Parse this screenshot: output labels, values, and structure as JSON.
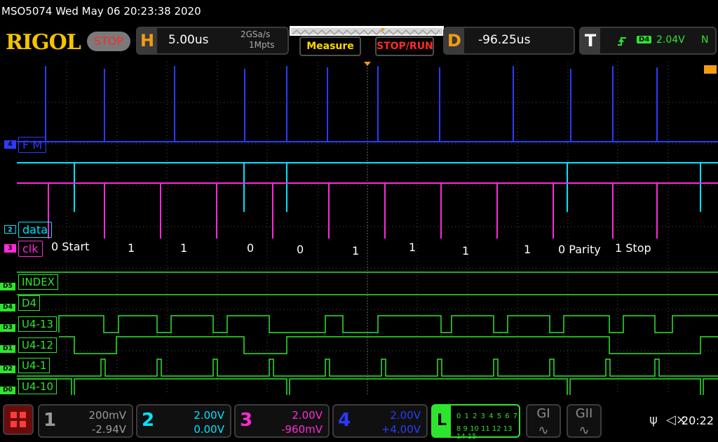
{
  "title_bar": {
    "info": "MSO5074  Wed May 06 20:23:38 2020"
  },
  "logo": "RIGOL",
  "status_button": "STOP",
  "horizontal": {
    "key": "H",
    "timebase": "5.00us",
    "sample_rate": "2GSa/s",
    "memory_depth": "1Mpts"
  },
  "buttons": {
    "measure": "Measure",
    "stop_run": "STOP/RUN"
  },
  "delay": {
    "key": "D",
    "value": "-96.25us"
  },
  "trigger": {
    "key": "T",
    "source": "D4",
    "level": "2.04V",
    "mode": "N"
  },
  "channels": [
    {
      "number": "1",
      "scale": "200mV",
      "offset": "-2.94V",
      "color": "#9a9a9a"
    },
    {
      "number": "2",
      "scale": "2.00V",
      "offset": "0.00V",
      "color": "#00e5ff"
    },
    {
      "number": "3",
      "scale": "2.00V",
      "offset": "-960mV",
      "color": "#ff2bd6"
    },
    {
      "number": "4",
      "scale": "2.00V",
      "offset": "+4.00V",
      "color": "#2a3bff"
    }
  ],
  "waveform_labels": {
    "ch4": "F M",
    "ch2": "data",
    "ch3": "clk",
    "ch4_marker": "4",
    "ch2_marker": "2",
    "ch3_marker": "3"
  },
  "annotations": [
    "0 Start",
    "1",
    "1",
    "0",
    "0",
    "1",
    "1",
    "1",
    "1",
    "0 Parity",
    "1 Stop"
  ],
  "digital_channels": [
    {
      "marker": "D5",
      "label": "INDEX"
    },
    {
      "marker": "D4",
      "label": "D4"
    },
    {
      "marker": "D3",
      "label": "U4-13"
    },
    {
      "marker": "D1",
      "label": "U4-12"
    },
    {
      "marker": "D2",
      "label": "U4-1"
    },
    {
      "marker": "D0",
      "label": "U4-10"
    }
  ],
  "la_panel": {
    "key": "L",
    "row1": "0 1 2 3  4 5 6 7",
    "row2": "8 9 10 11  12 13 14 15"
  },
  "generators": [
    {
      "label": "GI"
    },
    {
      "label": "GII"
    }
  ],
  "clock": "20:22",
  "icons": {
    "usb": "usb-icon",
    "sound": "mute-icon",
    "menu": "menu-grid-icon",
    "trigger_edge": "rising-edge-icon"
  }
}
